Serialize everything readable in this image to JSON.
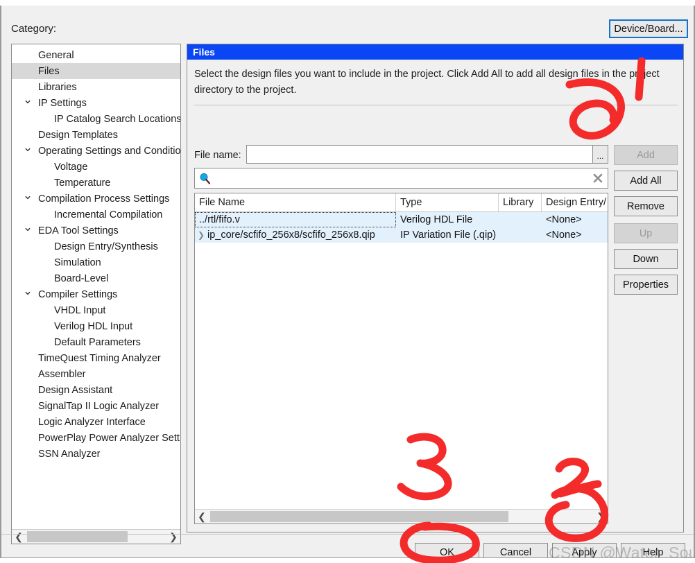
{
  "dialog": {
    "category_label": "Category:",
    "device_board_button": "Device/Board..."
  },
  "sidebar": {
    "items": [
      {
        "label": "General",
        "level": "top",
        "expander": "",
        "selected": false
      },
      {
        "label": "Files",
        "level": "top",
        "expander": "",
        "selected": true
      },
      {
        "label": "Libraries",
        "level": "top",
        "expander": "",
        "selected": false
      },
      {
        "label": "IP Settings",
        "level": "top",
        "expander": "chevron-down",
        "selected": false
      },
      {
        "label": "IP Catalog Search Locations",
        "level": "child",
        "expander": "",
        "selected": false
      },
      {
        "label": "Design Templates",
        "level": "top",
        "expander": "",
        "selected": false
      },
      {
        "label": "Operating Settings and Conditio",
        "level": "top",
        "expander": "chevron-down",
        "selected": false
      },
      {
        "label": "Voltage",
        "level": "child",
        "expander": "",
        "selected": false
      },
      {
        "label": "Temperature",
        "level": "child",
        "expander": "",
        "selected": false
      },
      {
        "label": "Compilation Process Settings",
        "level": "top",
        "expander": "chevron-down",
        "selected": false
      },
      {
        "label": "Incremental Compilation",
        "level": "child",
        "expander": "",
        "selected": false
      },
      {
        "label": "EDA Tool Settings",
        "level": "top",
        "expander": "chevron-down",
        "selected": false
      },
      {
        "label": "Design Entry/Synthesis",
        "level": "child",
        "expander": "",
        "selected": false
      },
      {
        "label": "Simulation",
        "level": "child",
        "expander": "",
        "selected": false
      },
      {
        "label": "Board-Level",
        "level": "child",
        "expander": "",
        "selected": false
      },
      {
        "label": "Compiler Settings",
        "level": "top",
        "expander": "chevron-down",
        "selected": false
      },
      {
        "label": "VHDL Input",
        "level": "child",
        "expander": "",
        "selected": false
      },
      {
        "label": "Verilog HDL Input",
        "level": "child",
        "expander": "",
        "selected": false
      },
      {
        "label": "Default Parameters",
        "level": "child",
        "expander": "",
        "selected": false
      },
      {
        "label": "TimeQuest Timing Analyzer",
        "level": "top",
        "expander": "",
        "selected": false
      },
      {
        "label": "Assembler",
        "level": "top",
        "expander": "",
        "selected": false
      },
      {
        "label": "Design Assistant",
        "level": "top",
        "expander": "",
        "selected": false
      },
      {
        "label": "SignalTap II Logic Analyzer",
        "level": "top",
        "expander": "",
        "selected": false
      },
      {
        "label": "Logic Analyzer Interface",
        "level": "top",
        "expander": "",
        "selected": false
      },
      {
        "label": "PowerPlay Power Analyzer Sett",
        "level": "top",
        "expander": "",
        "selected": false
      },
      {
        "label": "SSN Analyzer",
        "level": "top",
        "expander": "",
        "selected": false
      }
    ]
  },
  "panel": {
    "title": "Files",
    "description": "Select the design files you want to include in the project. Click Add All to add all design files in the project directory to the project.",
    "filename_label": "File name:",
    "filename_value": "",
    "filename_placeholder": "",
    "browse_button": "...",
    "search_value": "",
    "search_placeholder": ""
  },
  "table": {
    "columns": [
      "File Name",
      "Type",
      "Library",
      "Design Entry/"
    ],
    "rows": [
      {
        "file_name": "../rtl/fifo.v",
        "type": "Verilog HDL File",
        "library": "",
        "design_entry": "<None>",
        "expandable": false,
        "focused": true
      },
      {
        "file_name": "ip_core/scfifo_256x8/scfifo_256x8.qip",
        "type": "IP Variation File (.qip)",
        "library": "",
        "design_entry": "<None>",
        "expandable": true,
        "focused": false
      }
    ]
  },
  "side_buttons": [
    {
      "label": "Add",
      "enabled": false
    },
    {
      "label": "Add All",
      "enabled": true
    },
    {
      "label": "Remove",
      "enabled": true
    },
    {
      "label": "Up",
      "enabled": false
    },
    {
      "label": "Down",
      "enabled": true
    },
    {
      "label": "Properties",
      "enabled": true
    }
  ],
  "footer_buttons": {
    "ok": "OK",
    "cancel": "Cancel",
    "apply": "Apply",
    "help": "Help"
  },
  "annotations": {
    "marks": [
      "1",
      "2",
      "3"
    ],
    "color": "#f42b2b"
  },
  "watermark": "CSDN @Water_Sounds",
  "colors": {
    "panel_title_bg": "#0a46f5",
    "selection_row": "#e3f1fd",
    "tree_selected": "#d8d8d8",
    "focus_border": "#1473c8",
    "annotation_red": "#f42b2b"
  }
}
